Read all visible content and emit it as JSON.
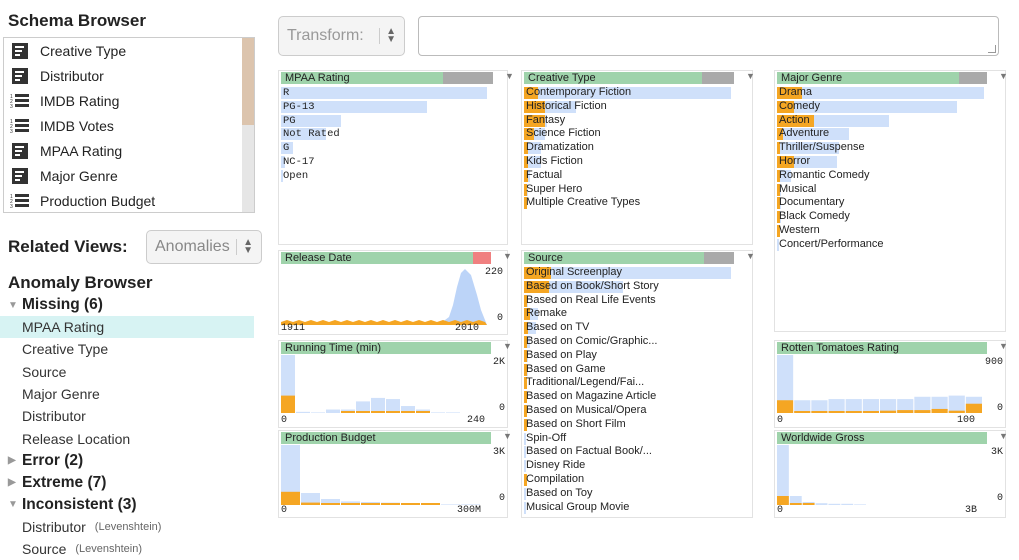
{
  "schema_browser": {
    "title": "Schema Browser",
    "items": [
      {
        "label": "Creative Type",
        "icon": "categorical-icon"
      },
      {
        "label": "Distributor",
        "icon": "categorical-icon"
      },
      {
        "label": "IMDB Rating",
        "icon": "numeric-icon"
      },
      {
        "label": "IMDB Votes",
        "icon": "numeric-icon"
      },
      {
        "label": "MPAA Rating",
        "icon": "categorical-icon"
      },
      {
        "label": "Major Genre",
        "icon": "categorical-icon"
      },
      {
        "label": "Production Budget",
        "icon": "numeric-icon"
      }
    ]
  },
  "related_views": {
    "label": "Related Views:",
    "selected": "Anomalies"
  },
  "anomaly_browser": {
    "title": "Anomaly Browser",
    "groups": [
      {
        "label": "Missing (6)",
        "expanded": true,
        "items": [
          {
            "label": "MPAA Rating",
            "selected": true
          },
          {
            "label": "Creative Type"
          },
          {
            "label": "Source"
          },
          {
            "label": "Major Genre"
          },
          {
            "label": "Distributor"
          },
          {
            "label": "Release Location"
          }
        ]
      },
      {
        "label": "Error (2)",
        "expanded": false,
        "items": []
      },
      {
        "label": "Extreme (7)",
        "expanded": false,
        "items": []
      },
      {
        "label": "Inconsistent (3)",
        "expanded": true,
        "items": [
          {
            "label": "Distributor",
            "note": "(Levenshtein)"
          },
          {
            "label": "Source",
            "note": "(Levenshtein)"
          }
        ]
      }
    ]
  },
  "toolbar": {
    "transform_label": "Transform:",
    "transform_input": ""
  },
  "colors": {
    "header": "#9fd3ab",
    "bar": "#cfe0fa",
    "missing": "#f5a623",
    "header_gray": "#aaaaaa",
    "header_red": "#f08080"
  },
  "panels": {
    "mpaa": {
      "title": "MPAA Rating",
      "rows": [
        {
          "label": "R",
          "v": 1.0,
          "o": 0
        },
        {
          "label": "PG-13",
          "v": 0.71,
          "o": 0
        },
        {
          "label": "PG",
          "v": 0.29,
          "o": 0
        },
        {
          "label": "Not Rated",
          "v": 0.22,
          "o": 0
        },
        {
          "label": "G",
          "v": 0.06,
          "o": 0
        },
        {
          "label": "NC-17",
          "v": 0.02,
          "o": 0
        },
        {
          "label": "Open",
          "v": 0.01,
          "o": 0
        }
      ]
    },
    "creative": {
      "title": "Creative Type",
      "rows": [
        {
          "label": "Contemporary Fiction",
          "v": 1.0,
          "o": 0.07
        },
        {
          "label": "Historical Fiction",
          "v": 0.25,
          "o": 0.1
        },
        {
          "label": "Fantasy",
          "v": 0.11,
          "o": 0.1
        },
        {
          "label": "Science Fiction",
          "v": 0.1,
          "o": 0.05
        },
        {
          "label": "Dramatization",
          "v": 0.08,
          "o": 0.02
        },
        {
          "label": "Kids Fiction",
          "v": 0.08,
          "o": 0.02
        },
        {
          "label": "Factual",
          "v": 0.03,
          "o": 0.02
        },
        {
          "label": "Super Hero",
          "v": 0.02,
          "o": 0.01
        },
        {
          "label": "Multiple Creative Types",
          "v": 0.01,
          "o": 0.01
        }
      ]
    },
    "genre": {
      "title": "Major Genre",
      "rows": [
        {
          "label": "Drama",
          "v": 1.0,
          "o": 0.12
        },
        {
          "label": "Comedy",
          "v": 0.87,
          "o": 0.08
        },
        {
          "label": "Action",
          "v": 0.54,
          "o": 0.18
        },
        {
          "label": "Adventure",
          "v": 0.35,
          "o": 0.03
        },
        {
          "label": "Thriller/Suspense",
          "v": 0.3,
          "o": 0.01
        },
        {
          "label": "Horror",
          "v": 0.29,
          "o": 0.08
        },
        {
          "label": "Romantic Comedy",
          "v": 0.07,
          "o": 0.01
        },
        {
          "label": "Musical",
          "v": 0.02,
          "o": 0.01
        },
        {
          "label": "Documentary",
          "v": 0.02,
          "o": 0.01
        },
        {
          "label": "Black Comedy",
          "v": 0.02,
          "o": 0.01
        },
        {
          "label": "Western",
          "v": 0.01,
          "o": 0.01
        },
        {
          "label": "Concert/Performance",
          "v": 0.005,
          "o": 0
        }
      ]
    },
    "source": {
      "title": "Source",
      "rows": [
        {
          "label": "Original Screenplay",
          "v": 1.0,
          "o": 0.13
        },
        {
          "label": "Based on Book/Short Story",
          "v": 0.48,
          "o": 0.12
        },
        {
          "label": "Based on Real Life Events",
          "v": 0.02,
          "o": 0.01
        },
        {
          "label": "Remake",
          "v": 0.07,
          "o": 0.03
        },
        {
          "label": "Based on TV",
          "v": 0.06,
          "o": 0.02
        },
        {
          "label": "Based on Comic/Graphic...",
          "v": 0.03,
          "o": 0.01
        },
        {
          "label": "Based on Play",
          "v": 0.02,
          "o": 0.01
        },
        {
          "label": "Based on Game",
          "v": 0.02,
          "o": 0.01
        },
        {
          "label": "Traditional/Legend/Fai...",
          "v": 0.01,
          "o": 0.01
        },
        {
          "label": "Based on Magazine Article",
          "v": 0.01,
          "o": 0.01
        },
        {
          "label": "Based on Musical/Opera",
          "v": 0.01,
          "o": 0.01
        },
        {
          "label": "Based on Short Film",
          "v": 0.01,
          "o": 0.01
        },
        {
          "label": "Spin-Off",
          "v": 0.01,
          "o": 0
        },
        {
          "label": "Based on Factual Book/...",
          "v": 0.01,
          "o": 0
        },
        {
          "label": "Disney Ride",
          "v": 0.01,
          "o": 0
        },
        {
          "label": "Compilation",
          "v": 0.01,
          "o": 0.01
        },
        {
          "label": "Based on Toy",
          "v": 0.01,
          "o": 0
        },
        {
          "label": "Musical Group Movie",
          "v": 0.005,
          "o": 0
        }
      ]
    },
    "release": {
      "title": "Release Date",
      "x_min": "1911",
      "x_max": "2010",
      "y_max": "220",
      "y_min": "0"
    },
    "running": {
      "title": "Running Time (min)",
      "x_min": "0",
      "x_max": "240",
      "y_max": "2K",
      "y_min": "0",
      "bins": [
        1.0,
        0.02,
        0.01,
        0.06,
        0.06,
        0.2,
        0.26,
        0.24,
        0.12,
        0.06,
        0.01,
        0.01
      ],
      "missing": [
        0.3,
        0,
        0,
        0,
        0.01,
        0.01,
        0.01,
        0.01,
        0.01,
        0.005,
        0,
        0
      ]
    },
    "budget": {
      "title": "Production Budget",
      "x_min": "0",
      "x_max": "300M",
      "y_max": "3K",
      "y_min": "0",
      "bins": [
        1.0,
        0.2,
        0.1,
        0.06,
        0.05,
        0.04,
        0.03,
        0.02,
        0.01,
        0.01
      ],
      "missing": [
        0.22,
        0.04,
        0.02,
        0.01,
        0.01,
        0.01,
        0.01,
        0.01,
        0,
        0
      ]
    },
    "rotten": {
      "title": "Rotten Tomatoes Rating",
      "x_min": "0",
      "x_max": "100",
      "y_max": "900",
      "y_min": "0",
      "bins": [
        1.0,
        0.22,
        0.22,
        0.24,
        0.24,
        0.24,
        0.24,
        0.24,
        0.28,
        0.28,
        0.3,
        0.28
      ],
      "missing": [
        0.22,
        0.02,
        0.02,
        0.03,
        0.02,
        0.03,
        0.04,
        0.05,
        0.05,
        0.07,
        0.04,
        0.16
      ]
    },
    "gross": {
      "title": "Worldwide Gross",
      "x_min": "0",
      "x_max": "3B",
      "y_max": "3K",
      "y_min": "0",
      "bins": [
        1.0,
        0.15,
        0.05,
        0.03,
        0.02,
        0.02,
        0.01
      ],
      "missing": [
        0.15,
        0.02,
        0.01,
        0,
        0,
        0,
        0
      ]
    }
  }
}
